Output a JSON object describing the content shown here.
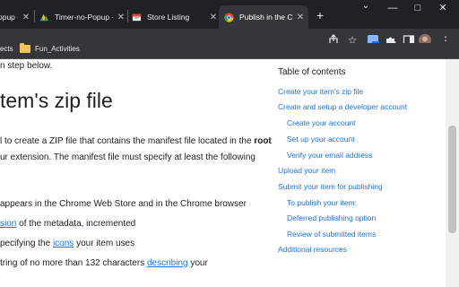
{
  "tabs": [
    {
      "title": "opup - (",
      "favicon": "tab-favicon-icon"
    },
    {
      "title": "Timer-no-Popup - (",
      "favicon": "chrome-webstore-icon"
    },
    {
      "title": "Store Listing",
      "favicon": "store-listing-icon"
    },
    {
      "title": "Publish in the Chro",
      "favicon": "chrome-icon",
      "active": true
    }
  ],
  "toolbar": {
    "new_tab": "+",
    "window_minimize": "—",
    "window_maximize": "□",
    "window_close": "✕"
  },
  "bookmarks": {
    "left_cut": "ects",
    "folder_label": "Fun_Activities"
  },
  "article": {
    "line_step": "n step below.",
    "heading": "tem's zip file",
    "para1_a": "l to create a ZIP file that contains the manifest file located in the ",
    "para1_bold": "root",
    "para2": "ur extension. The manifest file must specify at least the following",
    "line3": "appears in the Chrome Web Store and in the Chrome browser",
    "line4_link": "sion",
    "line4_rest": " of the metadata, incremented",
    "line5_a": "pecifying the ",
    "line5_link": "icons",
    "line5_rest": " your item uses",
    "line6_a": "tring of no more than 132 characters ",
    "line6_link": "describing",
    "line6_rest": " your"
  },
  "toc": {
    "title": "Table of contents",
    "items": [
      "Create your item's zip file",
      "Create and setup a developer account",
      "Create your account",
      "Set up your account",
      "Verify your email address",
      "Upload your item",
      "Submit your item for publishing",
      "To publish your item:",
      "Deferred publishing option",
      "Review of submitted items",
      "Additional resources"
    ]
  },
  "colors": {
    "link": "#1a73e8",
    "tabstrip": "#202124",
    "toolbar": "#35363a"
  }
}
